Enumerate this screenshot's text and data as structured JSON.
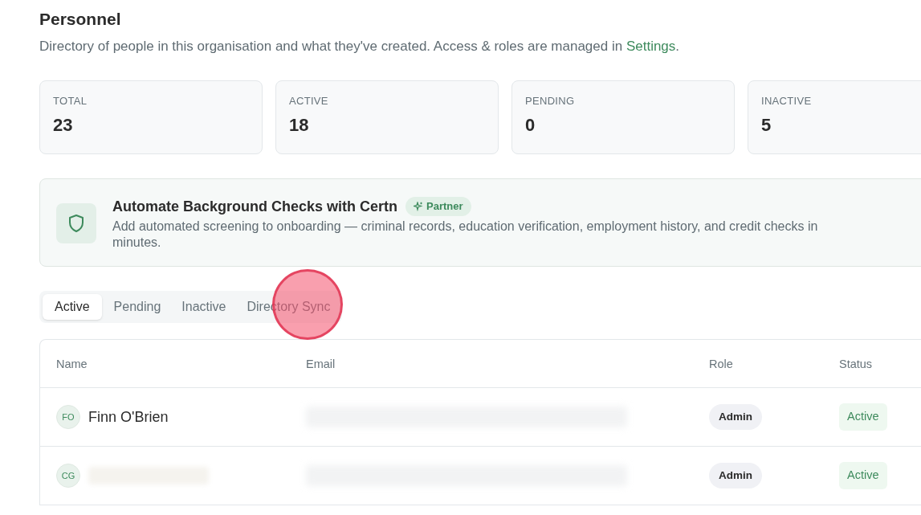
{
  "page": {
    "title": "Personnel",
    "description": "Directory of people in this organisation and what they've created. Access & roles are managed in ",
    "description_link": "Settings",
    "description_end": "."
  },
  "stats": [
    {
      "label": "TOTAL",
      "value": "23"
    },
    {
      "label": "ACTIVE",
      "value": "18"
    },
    {
      "label": "PENDING",
      "value": "0"
    },
    {
      "label": "INACTIVE",
      "value": "5"
    }
  ],
  "banner": {
    "title": "Automate Background Checks with Certn",
    "badge": "Partner",
    "text": "Add automated screening to onboarding — criminal records, education verification, employment history, and credit checks in minutes."
  },
  "tabs": [
    {
      "label": "Active",
      "selected": true
    },
    {
      "label": "Pending",
      "selected": false
    },
    {
      "label": "Inactive",
      "selected": false
    },
    {
      "label": "Directory Sync",
      "selected": false
    }
  ],
  "table": {
    "columns": [
      "Name",
      "Email",
      "Role",
      "Status"
    ],
    "rows": [
      {
        "initials": "FO",
        "name": "Finn O'Brien",
        "name_redacted": false,
        "role": "Admin",
        "status": "Active"
      },
      {
        "initials": "CG",
        "name_redacted": true,
        "role": "Admin",
        "status": "Active"
      }
    ]
  },
  "click_indicator": {
    "visible": true
  }
}
